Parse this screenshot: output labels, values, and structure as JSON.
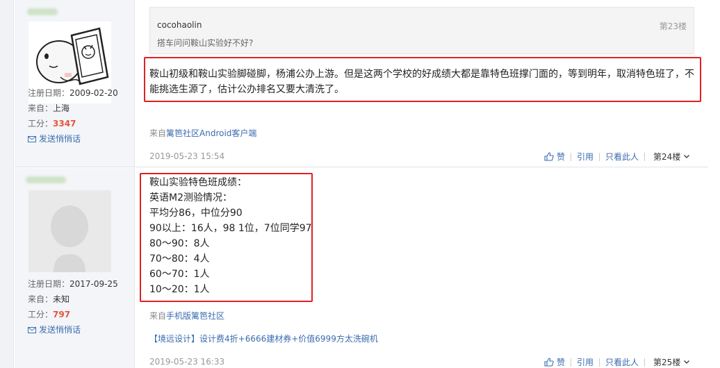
{
  "posts": [
    {
      "user": {
        "reg_label": "注册日期：",
        "reg_date": "2009-02-20",
        "from_label": "来自：",
        "from_value": "上海",
        "points_label": "工分：",
        "points": "3347",
        "pm_label": "发送悄悄话"
      },
      "quote": {
        "name": "cocohaolin",
        "floor": "第23楼",
        "text": "搭车问问鞍山实验好不好?"
      },
      "content": [
        "鞍山初级和鞍山实验脚碰脚，杨浦公办上游。但是这两个学校的好成绩大都是靠特色班撑门面的，等到明年，取消特色班了，不",
        "能挑选生源了，估计公办排名又要大清洗了。"
      ],
      "from_prefix": "来自",
      "from_link": "篱笆社区Android客户端",
      "date": "2019-05-23 15:54",
      "actions": {
        "like": "赞",
        "quote": "引用",
        "only": "只看此人"
      },
      "floor": "第24楼"
    },
    {
      "user": {
        "reg_label": "注册日期：",
        "reg_date": "2017-09-25",
        "from_label": "来自：",
        "from_value": "未知",
        "points_label": "工分：",
        "points": "797",
        "pm_label": "发送悄悄话"
      },
      "content": [
        "鞍山实验特色班成绩：",
        "英语M2测验情况：",
        "平均分86，中位分90",
        "90以上：16人，98 1位，7位同学97",
        "80～90：8人",
        "70～80：4人",
        "60～70：1人",
        "10～20：1人"
      ],
      "from_prefix": "来自",
      "from_link": "手机版篱笆社区",
      "ad": "【境远设计】设计费4折+6666建材券+价值6999方太洗碗机",
      "date": "2019-05-23 16:33",
      "actions": {
        "like": "赞",
        "quote": "引用",
        "only": "只看此人"
      },
      "floor": "第25楼"
    }
  ]
}
